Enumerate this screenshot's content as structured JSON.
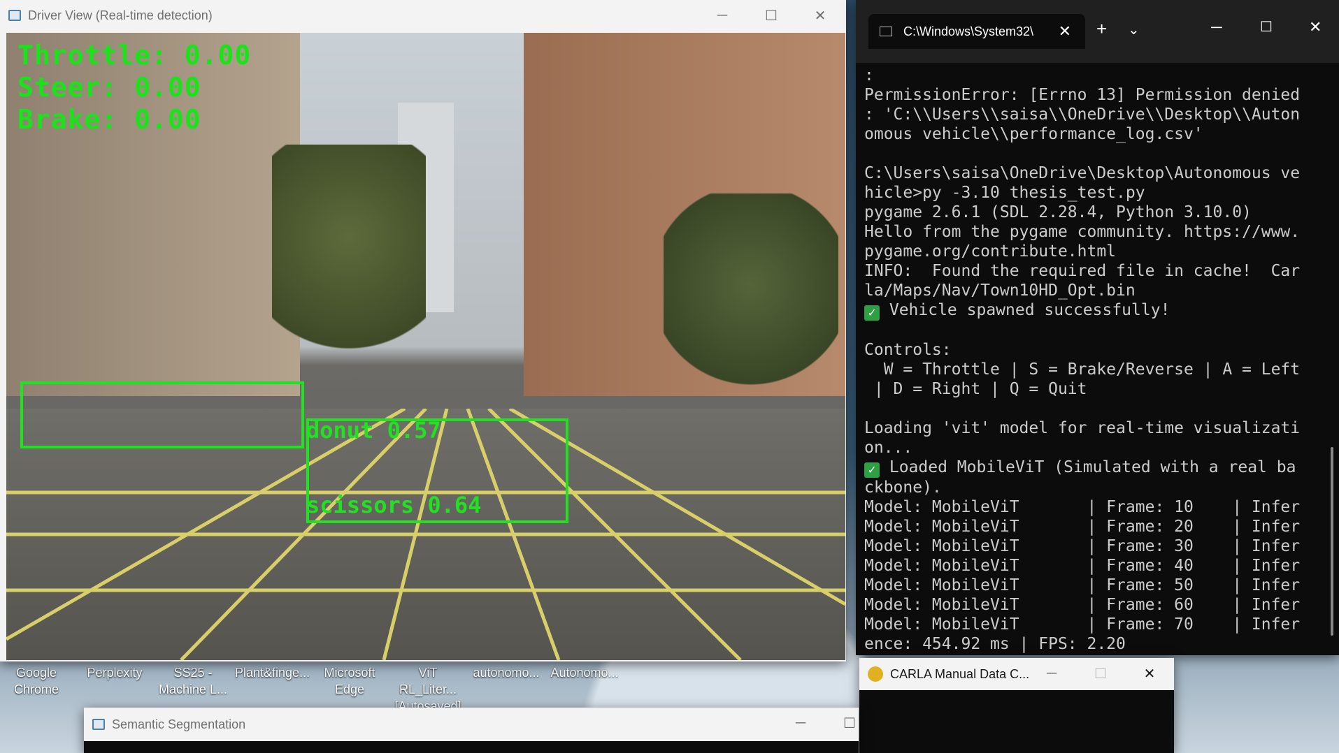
{
  "desktop_icons": [
    {
      "label": "Google Chrome"
    },
    {
      "label": "Perplexity"
    },
    {
      "label": "SS25 - Machine L..."
    },
    {
      "label": "Plant&finge..."
    },
    {
      "label": "Microsoft Edge"
    },
    {
      "label": "ViT RL_Liter... [Autosaved]"
    },
    {
      "label": "autonomo..."
    },
    {
      "label": "Autonomo..."
    }
  ],
  "driver_window": {
    "title": "Driver View (Real-time detection)",
    "hud": {
      "throttle": "Throttle: 0.00",
      "steer": "Steer: 0.00",
      "brake": "Brake: 0.00"
    },
    "detections": [
      {
        "label": "donut 0.57"
      },
      {
        "label": "scissors 0.64"
      }
    ]
  },
  "terminal": {
    "tab_title": "C:\\Windows\\System32\\",
    "lines": [
      ":",
      "PermissionError: [Errno 13] Permission denied",
      ": 'C:\\\\Users\\\\saisa\\\\OneDrive\\\\Desktop\\\\Auton",
      "omous vehicle\\\\performance_log.csv'",
      "",
      "C:\\Users\\saisa\\OneDrive\\Desktop\\Autonomous ve",
      "hicle>py -3.10 thesis_test.py",
      "pygame 2.6.1 (SDL 2.28.4, Python 3.10.0)",
      "Hello from the pygame community. https://www.",
      "pygame.org/contribute.html",
      "INFO:  Found the required file in cache!  Car",
      "la/Maps/Nav/Town10HD_Opt.bin",
      "✅ Vehicle spawned successfully!",
      "",
      "Controls:",
      "  W = Throttle | S = Brake/Reverse | A = Left",
      " | D = Right | Q = Quit",
      "",
      "Loading 'vit' model for real-time visualizati",
      "on...",
      "✅ Loaded MobileViT (Simulated with a real ba",
      "ckbone).",
      "Model: MobileViT       | Frame: 10    | Infer",
      "Model: MobileViT       | Frame: 20    | Infer",
      "Model: MobileViT       | Frame: 30    | Infer",
      "Model: MobileViT       | Frame: 40    | Infer",
      "Model: MobileViT       | Frame: 50    | Infer",
      "Model: MobileViT       | Frame: 60    | Infer",
      "Model: MobileViT       | Frame: 70    | Infer",
      "ence: 454.92 ms | FPS: 2.20"
    ]
  },
  "carla_window": {
    "title": "CARLA Manual Data C..."
  },
  "seg_window": {
    "title": "Semantic Segmentation"
  },
  "colors": {
    "hud_green": "#19e319",
    "terminal_bg": "#0c0c0c",
    "check_green": "#2ea043"
  }
}
